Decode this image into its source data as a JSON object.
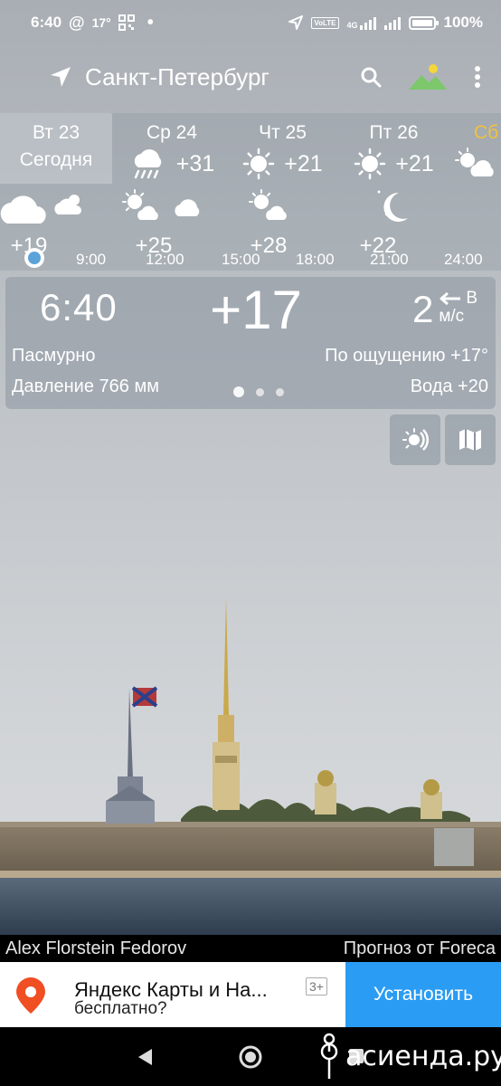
{
  "status_bar": {
    "time": "6:40",
    "temp": "17°",
    "battery": "100%",
    "network": "4G",
    "volte": "VoLTE"
  },
  "app_bar": {
    "city": "Санкт-Петербург",
    "icons": [
      "location-arrow-icon",
      "search-icon",
      "landscape-icon",
      "more-vert-icon"
    ]
  },
  "days": [
    {
      "name": "Вт 23",
      "sub": "Сегодня",
      "selected": true
    },
    {
      "name": "Ср 24",
      "temp": "+31",
      "icon": "rain-cloud-icon"
    },
    {
      "name": "Чт 25",
      "temp": "+21",
      "icon": "sun-icon"
    },
    {
      "name": "Пт 26",
      "temp": "+21",
      "icon": "sun-icon"
    },
    {
      "name": "Сб",
      "icon": "sun-cloud-icon",
      "color": "#f0c040"
    }
  ],
  "hours": [
    {
      "temp": "+19",
      "icon": "cloud-icon"
    },
    {
      "temp": "+25",
      "icon": "sun-cloud-icon"
    },
    {
      "temp": "+28",
      "icon": "sun-cloud-icon"
    },
    {
      "temp": "+22",
      "icon": "moon-icon"
    }
  ],
  "hour_labels": [
    "9:00",
    "12:00",
    "15:00",
    "18:00",
    "21:00",
    "24:00"
  ],
  "current": {
    "time": "6:40",
    "temp": "+17",
    "wind_speed": "2",
    "wind_dir": "В",
    "wind_unit": "м/с",
    "condition": "Пасмурно",
    "feels_like": "По ощущению +17°",
    "pressure": "Давление 766 мм",
    "water": "Вода +20",
    "page_count": 3,
    "page_active": 1
  },
  "credits": {
    "photo_author": "Alex Florstein Fedorov",
    "forecast_source": "Прогноз от Foreca"
  },
  "ad": {
    "title": "Яндекс Карты и На...",
    "subtitle": "бесплатно?",
    "age": "3+",
    "install": "Установить"
  },
  "watermark": "асиенда.ру",
  "colors": {
    "install_blue": "#2a9cf3",
    "ad_pin": "#f04e23",
    "landscape_green": "#7cc86b",
    "landscape_sun": "#f4d63a",
    "next_day_yellow": "#f0c040"
  }
}
